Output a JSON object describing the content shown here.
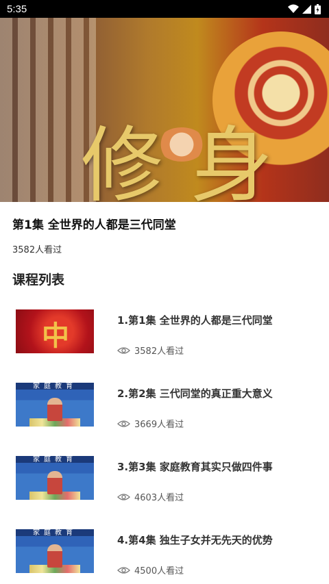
{
  "status_bar": {
    "time": "5:35",
    "icons": [
      "wifi-icon",
      "signal-icon",
      "battery-icon"
    ]
  },
  "hero": {
    "glyph": "修身"
  },
  "episode": {
    "title": "第1集  全世界的人都是三代同堂",
    "views": "3582人看过"
  },
  "section_title": "课程列表",
  "courses": [
    {
      "title": "1.第1集  全世界的人都是三代同堂",
      "views": "3582人看过",
      "thumb": "red",
      "thumb_glyph": "中"
    },
    {
      "title": "2.第2集 三代同堂的真正重大意义",
      "views": "3669人看过",
      "thumb": "class",
      "banner": "家庭教育"
    },
    {
      "title": "3.第3集 家庭教育其实只做四件事",
      "views": "4603人看过",
      "thumb": "class",
      "banner": "家庭教育"
    },
    {
      "title": "4.第4集 独生子女并无先天的优势",
      "views": "4500人看过",
      "thumb": "class",
      "banner": "家庭教育"
    }
  ]
}
